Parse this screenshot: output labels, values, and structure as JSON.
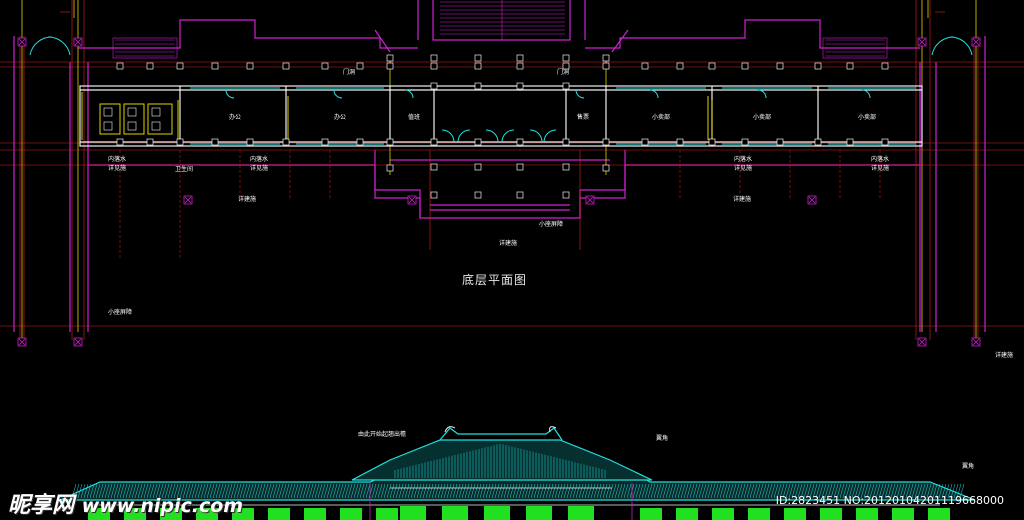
{
  "drawing": {
    "title": "底层平面图",
    "labels": {
      "door_l": "门洞",
      "door_r": "门洞",
      "office1": "办公",
      "office2": "办公",
      "duty": "值班",
      "shop": "售票",
      "room1": "小卖部",
      "room2": "小卖部",
      "room3": "小卖部",
      "drain_l1_a": "内落水",
      "drain_l1_b": "详见施",
      "toilet": "卫生间",
      "drain_l2_a": "内落水",
      "drain_l2_b": "详见施",
      "drain_r1_a": "内落水",
      "drain_r1_b": "详见施",
      "drain_r2_a": "内落水",
      "drain_r2_b": "详见施",
      "detail_l": "详建施",
      "detail_r": "详建施",
      "small_parapet": "小座屏障",
      "detail_center": "详建施",
      "small_parapet_l": "小座屏障",
      "detail_far_r": "详建施",
      "elev_note": "由此开始起翘出檐",
      "ridge_l": "翼角",
      "ridge_r": "翼角"
    }
  },
  "watermark": {
    "logo_cn": "昵享网",
    "logo_domain": "www.nipic.com",
    "id_text": "ID:2823451 NO:20120104201119668000"
  }
}
